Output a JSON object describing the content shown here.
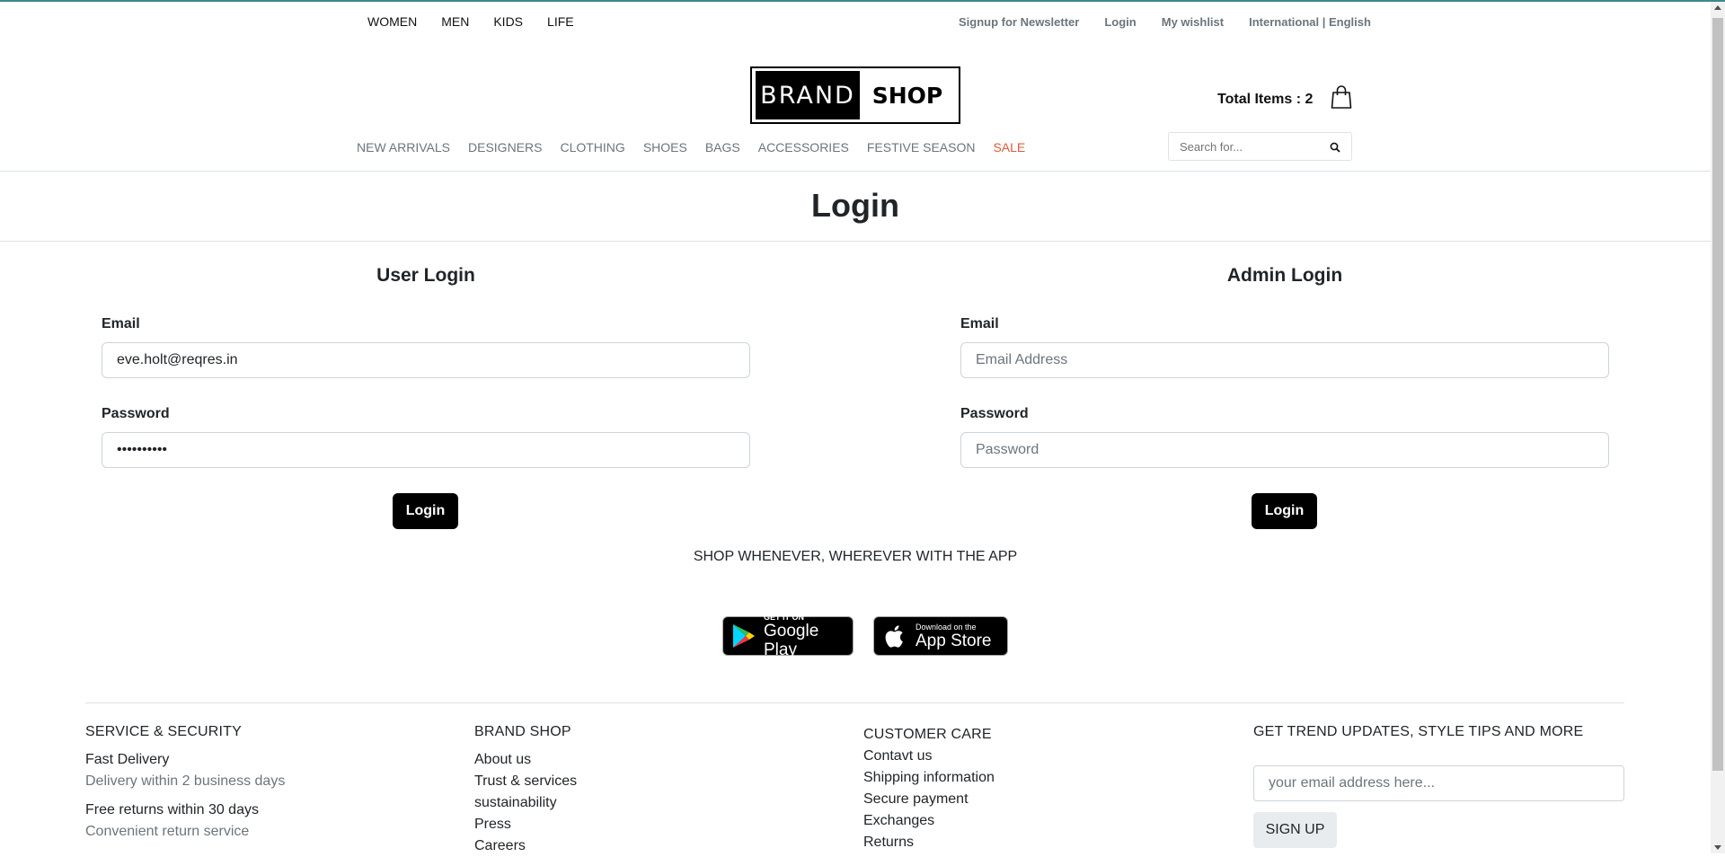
{
  "top_nav": {
    "left": [
      "WOMEN",
      "MEN",
      "KIDS",
      "LIFE"
    ],
    "right": [
      "Signup for Newsletter",
      "Login",
      "My wishlist",
      "International | English"
    ]
  },
  "logo": {
    "left": "BRAND",
    "right": "SHOP"
  },
  "cart": {
    "label": "Total Items : 2",
    "icon": "shopping-bag-icon"
  },
  "categories": [
    "NEW ARRIVALS",
    "DESIGNERS",
    "CLOTHING",
    "SHOES",
    "BAGS",
    "ACCESSORIES",
    "FESTIVE SEASON",
    "SALE"
  ],
  "search": {
    "placeholder": "Search for...",
    "icon": "search-icon"
  },
  "page_title": "Login",
  "user_login": {
    "title": "User Login",
    "email_label": "Email",
    "email_value": "eve.holt@reqres.in",
    "password_label": "Password",
    "password_value": "••••••••••",
    "button": "Login"
  },
  "admin_login": {
    "title": "Admin Login",
    "email_label": "Email",
    "email_placeholder": "Email Address",
    "password_label": "Password",
    "password_placeholder": "Password",
    "button": "Login"
  },
  "app_promo": {
    "text": "SHOP WHENEVER, WHEREVER WITH THE APP",
    "google_play": {
      "small": "GET IT ON",
      "big": "Google Play"
    },
    "app_store": {
      "small": "Download on the",
      "big": "App Store"
    }
  },
  "footer": {
    "service": {
      "heading": "SERVICE & SECURITY",
      "item1": "Fast Delivery",
      "item1_sub": "Delivery within 2 business days",
      "item2": "Free returns within 30 days",
      "item2_sub": "Convenient return service"
    },
    "brand": {
      "heading": "BRAND SHOP",
      "links": [
        "About us",
        "Trust & services",
        "sustainability",
        "Press",
        "Careers"
      ]
    },
    "care": {
      "heading": "CUSTOMER CARE",
      "links": [
        "Contavt us",
        "Shipping information",
        "Secure payment",
        "Exchanges",
        "Returns"
      ]
    },
    "newsletter": {
      "heading": "GET TREND UPDATES, STYLE TIPS AND MORE",
      "placeholder": "your email address here...",
      "button": "SIGN UP"
    }
  },
  "colors": {
    "sale": "#e05a3a",
    "accent_border": "#3b8a8f",
    "button": "#000000"
  }
}
